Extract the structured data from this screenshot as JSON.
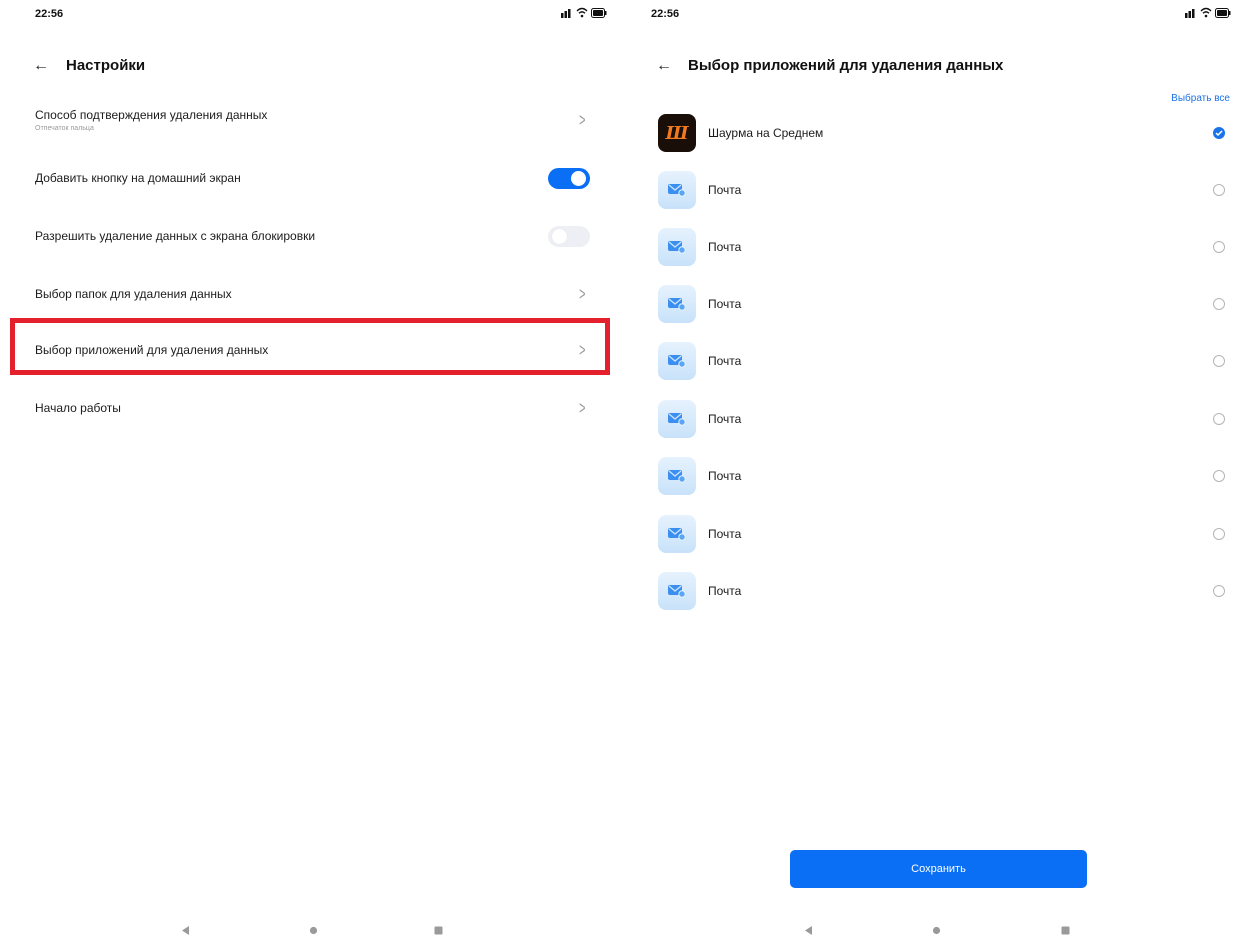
{
  "left_screen": {
    "status_time": "22:56",
    "title": "Настройки",
    "rows": [
      {
        "label": "Способ подтверждения удаления данных",
        "sublabel": "Отпечаток пальца"
      },
      {
        "label": "Добавить кнопку на домашний экран",
        "toggle_on": true
      },
      {
        "label": "Разрешить удаление данных с экрана блокировки",
        "toggle_on": false
      },
      {
        "label": "Выбор папок для удаления данных"
      },
      {
        "label": "Выбор приложений для удаления данных"
      },
      {
        "label": "Начало работы"
      }
    ]
  },
  "right_screen": {
    "status_time": "22:56",
    "title": "Выбор приложений для удаления данных",
    "select_all_label": "Выбрать все",
    "apps": [
      {
        "name": "Шаурма на Среднем",
        "icon": "shawarma-app-icon",
        "checked": true
      },
      {
        "name": "Почта",
        "icon": "mail-app-icon",
        "checked": false
      },
      {
        "name": "Почта",
        "icon": "mail-app-icon",
        "checked": false
      },
      {
        "name": "Почта",
        "icon": "mail-app-icon",
        "checked": false
      },
      {
        "name": "Почта",
        "icon": "mail-app-icon",
        "checked": false
      },
      {
        "name": "Почта",
        "icon": "mail-app-icon",
        "checked": false
      },
      {
        "name": "Почта",
        "icon": "mail-app-icon",
        "checked": false
      },
      {
        "name": "Почта",
        "icon": "mail-app-icon",
        "checked": false
      },
      {
        "name": "Почта",
        "icon": "mail-app-icon",
        "checked": false
      }
    ],
    "save_label": "Сохранить"
  },
  "colors": {
    "accent": "#0b6ff5",
    "link": "#1a73e8",
    "highlight_frame": "#e3202b"
  }
}
